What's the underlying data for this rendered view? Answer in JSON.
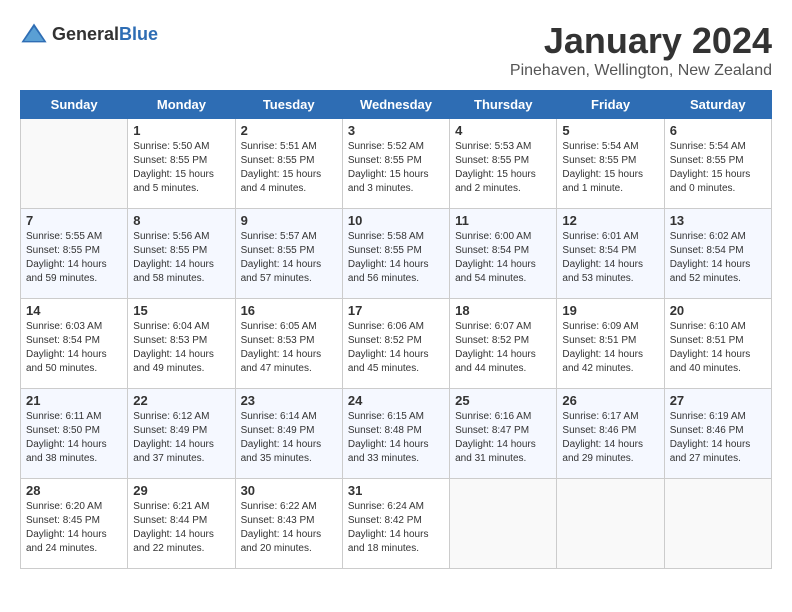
{
  "header": {
    "logo_general": "General",
    "logo_blue": "Blue",
    "month_title": "January 2024",
    "location": "Pinehaven, Wellington, New Zealand"
  },
  "weekdays": [
    "Sunday",
    "Monday",
    "Tuesday",
    "Wednesday",
    "Thursday",
    "Friday",
    "Saturday"
  ],
  "weeks": [
    [
      {
        "day": "",
        "sunrise": "",
        "sunset": "",
        "daylight": ""
      },
      {
        "day": "1",
        "sunrise": "Sunrise: 5:50 AM",
        "sunset": "Sunset: 8:55 PM",
        "daylight": "Daylight: 15 hours and 5 minutes."
      },
      {
        "day": "2",
        "sunrise": "Sunrise: 5:51 AM",
        "sunset": "Sunset: 8:55 PM",
        "daylight": "Daylight: 15 hours and 4 minutes."
      },
      {
        "day": "3",
        "sunrise": "Sunrise: 5:52 AM",
        "sunset": "Sunset: 8:55 PM",
        "daylight": "Daylight: 15 hours and 3 minutes."
      },
      {
        "day": "4",
        "sunrise": "Sunrise: 5:53 AM",
        "sunset": "Sunset: 8:55 PM",
        "daylight": "Daylight: 15 hours and 2 minutes."
      },
      {
        "day": "5",
        "sunrise": "Sunrise: 5:54 AM",
        "sunset": "Sunset: 8:55 PM",
        "daylight": "Daylight: 15 hours and 1 minute."
      },
      {
        "day": "6",
        "sunrise": "Sunrise: 5:54 AM",
        "sunset": "Sunset: 8:55 PM",
        "daylight": "Daylight: 15 hours and 0 minutes."
      }
    ],
    [
      {
        "day": "7",
        "sunrise": "Sunrise: 5:55 AM",
        "sunset": "Sunset: 8:55 PM",
        "daylight": "Daylight: 14 hours and 59 minutes."
      },
      {
        "day": "8",
        "sunrise": "Sunrise: 5:56 AM",
        "sunset": "Sunset: 8:55 PM",
        "daylight": "Daylight: 14 hours and 58 minutes."
      },
      {
        "day": "9",
        "sunrise": "Sunrise: 5:57 AM",
        "sunset": "Sunset: 8:55 PM",
        "daylight": "Daylight: 14 hours and 57 minutes."
      },
      {
        "day": "10",
        "sunrise": "Sunrise: 5:58 AM",
        "sunset": "Sunset: 8:55 PM",
        "daylight": "Daylight: 14 hours and 56 minutes."
      },
      {
        "day": "11",
        "sunrise": "Sunrise: 6:00 AM",
        "sunset": "Sunset: 8:54 PM",
        "daylight": "Daylight: 14 hours and 54 minutes."
      },
      {
        "day": "12",
        "sunrise": "Sunrise: 6:01 AM",
        "sunset": "Sunset: 8:54 PM",
        "daylight": "Daylight: 14 hours and 53 minutes."
      },
      {
        "day": "13",
        "sunrise": "Sunrise: 6:02 AM",
        "sunset": "Sunset: 8:54 PM",
        "daylight": "Daylight: 14 hours and 52 minutes."
      }
    ],
    [
      {
        "day": "14",
        "sunrise": "Sunrise: 6:03 AM",
        "sunset": "Sunset: 8:54 PM",
        "daylight": "Daylight: 14 hours and 50 minutes."
      },
      {
        "day": "15",
        "sunrise": "Sunrise: 6:04 AM",
        "sunset": "Sunset: 8:53 PM",
        "daylight": "Daylight: 14 hours and 49 minutes."
      },
      {
        "day": "16",
        "sunrise": "Sunrise: 6:05 AM",
        "sunset": "Sunset: 8:53 PM",
        "daylight": "Daylight: 14 hours and 47 minutes."
      },
      {
        "day": "17",
        "sunrise": "Sunrise: 6:06 AM",
        "sunset": "Sunset: 8:52 PM",
        "daylight": "Daylight: 14 hours and 45 minutes."
      },
      {
        "day": "18",
        "sunrise": "Sunrise: 6:07 AM",
        "sunset": "Sunset: 8:52 PM",
        "daylight": "Daylight: 14 hours and 44 minutes."
      },
      {
        "day": "19",
        "sunrise": "Sunrise: 6:09 AM",
        "sunset": "Sunset: 8:51 PM",
        "daylight": "Daylight: 14 hours and 42 minutes."
      },
      {
        "day": "20",
        "sunrise": "Sunrise: 6:10 AM",
        "sunset": "Sunset: 8:51 PM",
        "daylight": "Daylight: 14 hours and 40 minutes."
      }
    ],
    [
      {
        "day": "21",
        "sunrise": "Sunrise: 6:11 AM",
        "sunset": "Sunset: 8:50 PM",
        "daylight": "Daylight: 14 hours and 38 minutes."
      },
      {
        "day": "22",
        "sunrise": "Sunrise: 6:12 AM",
        "sunset": "Sunset: 8:49 PM",
        "daylight": "Daylight: 14 hours and 37 minutes."
      },
      {
        "day": "23",
        "sunrise": "Sunrise: 6:14 AM",
        "sunset": "Sunset: 8:49 PM",
        "daylight": "Daylight: 14 hours and 35 minutes."
      },
      {
        "day": "24",
        "sunrise": "Sunrise: 6:15 AM",
        "sunset": "Sunset: 8:48 PM",
        "daylight": "Daylight: 14 hours and 33 minutes."
      },
      {
        "day": "25",
        "sunrise": "Sunrise: 6:16 AM",
        "sunset": "Sunset: 8:47 PM",
        "daylight": "Daylight: 14 hours and 31 minutes."
      },
      {
        "day": "26",
        "sunrise": "Sunrise: 6:17 AM",
        "sunset": "Sunset: 8:46 PM",
        "daylight": "Daylight: 14 hours and 29 minutes."
      },
      {
        "day": "27",
        "sunrise": "Sunrise: 6:19 AM",
        "sunset": "Sunset: 8:46 PM",
        "daylight": "Daylight: 14 hours and 27 minutes."
      }
    ],
    [
      {
        "day": "28",
        "sunrise": "Sunrise: 6:20 AM",
        "sunset": "Sunset: 8:45 PM",
        "daylight": "Daylight: 14 hours and 24 minutes."
      },
      {
        "day": "29",
        "sunrise": "Sunrise: 6:21 AM",
        "sunset": "Sunset: 8:44 PM",
        "daylight": "Daylight: 14 hours and 22 minutes."
      },
      {
        "day": "30",
        "sunrise": "Sunrise: 6:22 AM",
        "sunset": "Sunset: 8:43 PM",
        "daylight": "Daylight: 14 hours and 20 minutes."
      },
      {
        "day": "31",
        "sunrise": "Sunrise: 6:24 AM",
        "sunset": "Sunset: 8:42 PM",
        "daylight": "Daylight: 14 hours and 18 minutes."
      },
      {
        "day": "",
        "sunrise": "",
        "sunset": "",
        "daylight": ""
      },
      {
        "day": "",
        "sunrise": "",
        "sunset": "",
        "daylight": ""
      },
      {
        "day": "",
        "sunrise": "",
        "sunset": "",
        "daylight": ""
      }
    ]
  ]
}
